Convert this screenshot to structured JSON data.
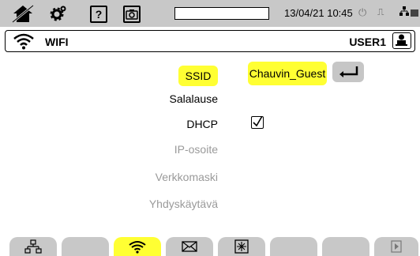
{
  "statusbar": {
    "home_icon": "home-icon",
    "gear_icon": "gear-icon",
    "help_label": "?",
    "camera_icon": "camera-icon",
    "datetime": "13/04/21 10:45",
    "power_icon": "power-icon",
    "usb_icon": "usb-icon",
    "network_icon": "network-icon",
    "battery_icon": "battery-icon"
  },
  "header": {
    "icon": "wifi-icon",
    "title": "WIFI",
    "user": "USER1",
    "lock_icon": "user-lock-icon"
  },
  "form": {
    "ssid_label": "SSID",
    "ssid_value": "Chauvin_Guest",
    "password_label": "Salalause",
    "dhcp_label": "DHCP",
    "dhcp_checked": true,
    "ip_label": "IP-osoite",
    "netmask_label": "Verkkomaski",
    "gateway_label": "Yhdyskäytävä"
  },
  "tabs": [
    {
      "icon": "ethernet-icon",
      "active": false
    },
    {
      "icon": "",
      "active": false
    },
    {
      "icon": "wifi-icon",
      "active": true
    },
    {
      "icon": "mail-icon",
      "active": false
    },
    {
      "icon": "server-icon",
      "active": false
    },
    {
      "icon": "",
      "active": false
    },
    {
      "icon": "",
      "active": false
    },
    {
      "icon": "next-page-icon",
      "active": false
    }
  ],
  "colors": {
    "highlight": "#ffff33",
    "statusbar_bg": "#c8c8c8",
    "dim_text": "#9a9a9a"
  }
}
